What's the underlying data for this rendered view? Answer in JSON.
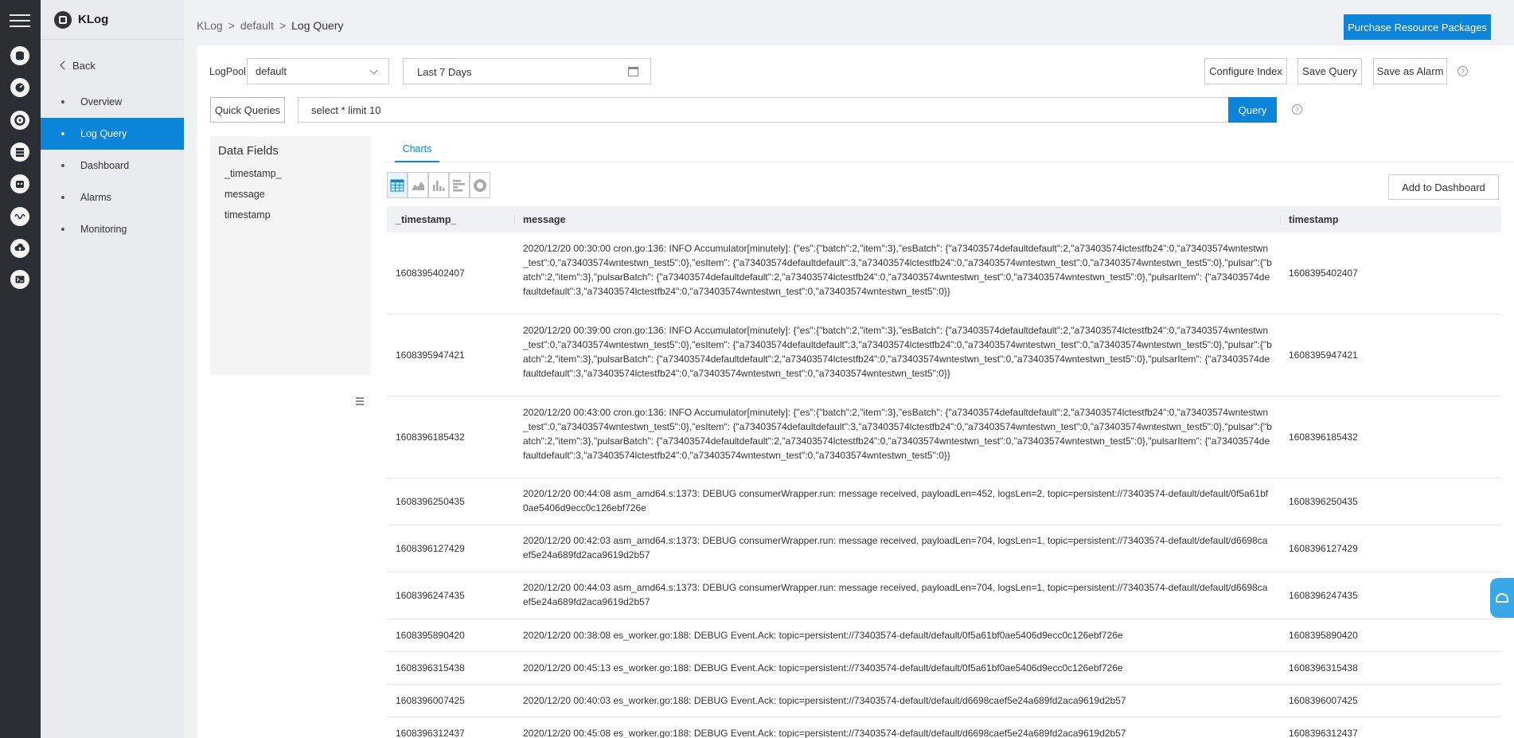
{
  "app": {
    "brand": "KLog"
  },
  "rail": {
    "icons": [
      "database-icon",
      "dashboard-gauge-icon",
      "lifebuoy-icon",
      "storage-icon",
      "robot-icon",
      "signal-wave-icon",
      "cloud-upload-icon",
      "terminal-icon"
    ]
  },
  "sidebar": {
    "back_label": "Back",
    "items": [
      {
        "label": "Overview",
        "active": false
      },
      {
        "label": "Log Query",
        "active": true
      },
      {
        "label": "Dashboard",
        "active": false
      },
      {
        "label": "Alarms",
        "active": false
      },
      {
        "label": "Monitoring",
        "active": false
      }
    ]
  },
  "breadcrumb": {
    "root": "KLog",
    "middle": "default",
    "current": "Log Query"
  },
  "header": {
    "purchase_label": "Purchase Resource Packages"
  },
  "toolbar": {
    "logpool_label": "LogPool",
    "logpool_value": "default",
    "time_range": "Last 7 Days",
    "configure_index": "Configure Index",
    "save_query": "Save Query",
    "save_alarm": "Save as Alarm"
  },
  "query": {
    "quick_label": "Quick Queries",
    "text": "select * limit 10",
    "submit_label": "Query"
  },
  "fields": {
    "heading": "Data Fields",
    "items": [
      "_timestamp_",
      "message",
      "timestamp"
    ]
  },
  "results": {
    "tab_label": "Charts",
    "add_dashboard": "Add to Dashboard",
    "columns": [
      "_timestamp_",
      "message",
      "timestamp"
    ],
    "rows": [
      {
        "ts": "1608395402407",
        "msg": "2020/12/20 00:30:00 cron.go:136: INFO Accumulator[minutely]: {\"es\":{\"batch\":2,\"item\":3},\"esBatch\": {\"a73403574defaultdefault\":2,\"a73403574lctestfb24\":0,\"a73403574wntestwn_test\":0,\"a73403574wntestwn_test5\":0},\"esItem\": {\"a73403574defaultdefault\":3,\"a73403574lctestfb24\":0,\"a73403574wntestwn_test\":0,\"a73403574wntestwn_test5\":0},\"pulsar\":{\"batch\":2,\"item\":3},\"pulsarBatch\": {\"a73403574defaultdefault\":2,\"a73403574lctestfb24\":0,\"a73403574wntestwn_test\":0,\"a73403574wntestwn_test5\":0},\"pulsarItem\": {\"a73403574defaultdefault\":3,\"a73403574lctestfb24\":0,\"a73403574wntestwn_test\":0,\"a73403574wntestwn_test5\":0}}",
        "timestamp": "1608395402407",
        "size": "tall"
      },
      {
        "ts": "1608395947421",
        "msg": "2020/12/20 00:39:00 cron.go:136: INFO Accumulator[minutely]: {\"es\":{\"batch\":2,\"item\":3},\"esBatch\": {\"a73403574defaultdefault\":2,\"a73403574lctestfb24\":0,\"a73403574wntestwn_test\":0,\"a73403574wntestwn_test5\":0},\"esItem\": {\"a73403574defaultdefault\":3,\"a73403574lctestfb24\":0,\"a73403574wntestwn_test\":0,\"a73403574wntestwn_test5\":0},\"pulsar\":{\"batch\":2,\"item\":3},\"pulsarBatch\": {\"a73403574defaultdefault\":2,\"a73403574lctestfb24\":0,\"a73403574wntestwn_test\":0,\"a73403574wntestwn_test5\":0},\"pulsarItem\": {\"a73403574defaultdefault\":3,\"a73403574lctestfb24\":0,\"a73403574wntestwn_test\":0,\"a73403574wntestwn_test5\":0}}",
        "timestamp": "1608395947421",
        "size": "tall"
      },
      {
        "ts": "1608396185432",
        "msg": "2020/12/20 00:43:00 cron.go:136: INFO Accumulator[minutely]: {\"es\":{\"batch\":2,\"item\":3},\"esBatch\": {\"a73403574defaultdefault\":2,\"a73403574lctestfb24\":0,\"a73403574wntestwn_test\":0,\"a73403574wntestwn_test5\":0},\"esItem\": {\"a73403574defaultdefault\":3,\"a73403574lctestfb24\":0,\"a73403574wntestwn_test\":0,\"a73403574wntestwn_test5\":0},\"pulsar\":{\"batch\":2,\"item\":3},\"pulsarBatch\": {\"a73403574defaultdefault\":2,\"a73403574lctestfb24\":0,\"a73403574wntestwn_test\":0,\"a73403574wntestwn_test5\":0},\"pulsarItem\": {\"a73403574defaultdefault\":3,\"a73403574lctestfb24\":0,\"a73403574wntestwn_test\":0,\"a73403574wntestwn_test5\":0}}",
        "timestamp": "1608396185432",
        "size": "tall"
      },
      {
        "ts": "1608396250435",
        "msg": "2020/12/20 00:44:08 asm_amd64.s:1373: DEBUG consumerWrapper.run: message received, payloadLen=452, logsLen=2, topic=persistent://73403574-default/default/0f5a61bf0ae5406d9ecc0c126ebf726e",
        "timestamp": "1608396250435",
        "size": "mid"
      },
      {
        "ts": "1608396127429",
        "msg": "2020/12/20 00:42:03 asm_amd64.s:1373: DEBUG consumerWrapper.run: message received, payloadLen=704, logsLen=1, topic=persistent://73403574-default/default/d6698caef5e24a689fd2aca9619d2b57",
        "timestamp": "1608396127429",
        "size": "mid"
      },
      {
        "ts": "1608396247435",
        "msg": "2020/12/20 00:44:03 asm_amd64.s:1373: DEBUG consumerWrapper.run: message received, payloadLen=704, logsLen=1, topic=persistent://73403574-default/default/d6698caef5e24a689fd2aca9619d2b57",
        "timestamp": "1608396247435",
        "size": "mid"
      },
      {
        "ts": "1608395890420",
        "msg": "2020/12/20 00:38:08 es_worker.go:188: DEBUG Event.Ack: topic=persistent://73403574-default/default/0f5a61bf0ae5406d9ecc0c126ebf726e",
        "timestamp": "1608395890420",
        "size": "short"
      },
      {
        "ts": "1608396315438",
        "msg": "2020/12/20 00:45:13 es_worker.go:188: DEBUG Event.Ack: topic=persistent://73403574-default/default/0f5a61bf0ae5406d9ecc0c126ebf726e",
        "timestamp": "1608396315438",
        "size": "short"
      },
      {
        "ts": "1608396007425",
        "msg": "2020/12/20 00:40:03 es_worker.go:188: DEBUG Event.Ack: topic=persistent://73403574-default/default/d6698caef5e24a689fd2aca9619d2b57",
        "timestamp": "1608396007425",
        "size": "short"
      },
      {
        "ts": "1608396312437",
        "msg": "2020/12/20 00:45:08 es_worker.go:188: DEBUG Event.Ack: topic=persistent://73403574-default/default/d6698caef5e24a689fd2aca9619d2b57",
        "timestamp": "1608396312437",
        "size": "short"
      }
    ]
  },
  "colors": {
    "accent": "#0a85d9",
    "rail": "#2b2e33",
    "sidebar": "#eaebee"
  }
}
